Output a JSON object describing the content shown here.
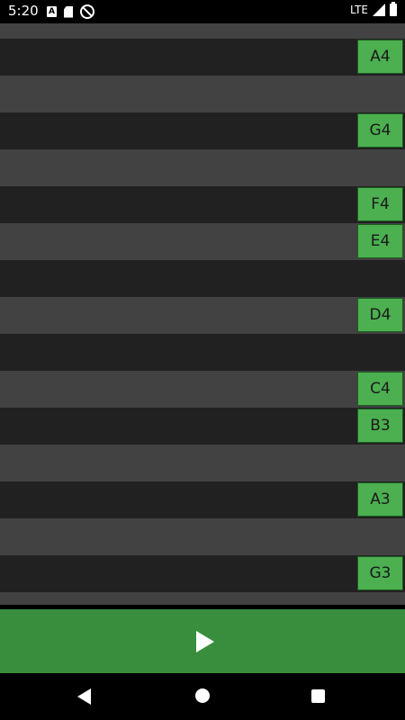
{
  "status_bar": {
    "time": "5:20",
    "left_icons": [
      "a-icon",
      "sd-card-icon",
      "no-sync-icon"
    ],
    "network": "LTE",
    "right_icons": [
      "signal-icon",
      "battery-icon"
    ]
  },
  "rows": [
    {
      "shade": "light",
      "note": ""
    },
    {
      "shade": "dark",
      "note": "A4"
    },
    {
      "shade": "light",
      "note": ""
    },
    {
      "shade": "dark",
      "note": "G4"
    },
    {
      "shade": "light",
      "note": ""
    },
    {
      "shade": "dark",
      "note": "F4"
    },
    {
      "shade": "light",
      "note": "E4"
    },
    {
      "shade": "dark",
      "note": ""
    },
    {
      "shade": "light",
      "note": "D4"
    },
    {
      "shade": "dark",
      "note": ""
    },
    {
      "shade": "light",
      "note": "C4"
    },
    {
      "shade": "dark",
      "note": "B3"
    },
    {
      "shade": "light",
      "note": ""
    },
    {
      "shade": "dark",
      "note": "A3"
    },
    {
      "shade": "light",
      "note": ""
    },
    {
      "shade": "dark",
      "note": "G3"
    },
    {
      "shade": "light",
      "note": ""
    }
  ],
  "play_button": {
    "icon": "play-icon",
    "color": "#388e3c"
  },
  "colors": {
    "note_key": "#4caf50",
    "row_light": "#424242",
    "row_dark": "#212121"
  },
  "nav_bar": {
    "icons": [
      "back-icon",
      "home-icon",
      "recents-icon"
    ]
  }
}
